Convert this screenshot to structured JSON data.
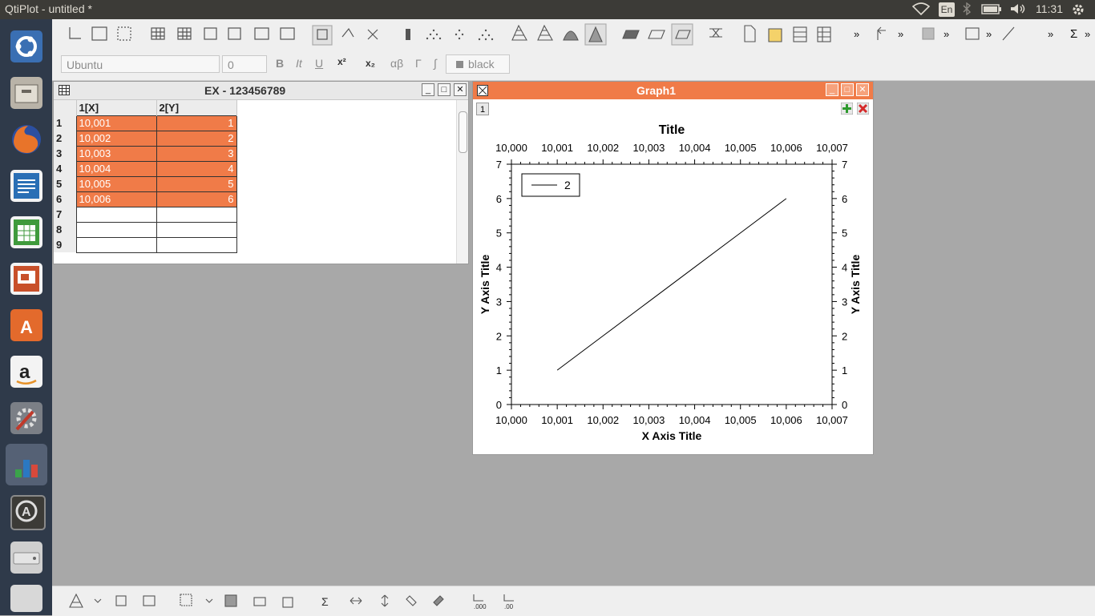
{
  "top_panel": {
    "app_title": "QtiPlot - untitled *",
    "lang": "En",
    "clock": "11:31"
  },
  "launcher": {
    "items": [
      "dash-icon",
      "files-icon",
      "firefox-icon",
      "writer-icon",
      "calc-icon",
      "impress-icon",
      "software-center-icon",
      "amazon-icon",
      "system-settings-icon",
      "qtiplot-icon",
      "software-updater-icon",
      "drive-icon",
      "trash-icon"
    ]
  },
  "format_toolbar": {
    "font": "Ubuntu",
    "size": "0",
    "bold": "B",
    "italic": "It",
    "underline": "U",
    "superscript": "x²",
    "subscript": "x₂",
    "greek_lower": "αβ",
    "greek_upper": "Γ",
    "integral": "∫",
    "color_label": "black"
  },
  "table_window": {
    "title": "EX - 123456789",
    "columns": [
      "1[X]",
      "2[Y]"
    ],
    "rows": [
      {
        "n": "1",
        "x": "10,001",
        "y": "1"
      },
      {
        "n": "2",
        "x": "10,002",
        "y": "2"
      },
      {
        "n": "3",
        "x": "10,003",
        "y": "3"
      },
      {
        "n": "4",
        "x": "10,004",
        "y": "4"
      },
      {
        "n": "5",
        "x": "10,005",
        "y": "5"
      },
      {
        "n": "6",
        "x": "10,006",
        "y": "6"
      },
      {
        "n": "7",
        "x": "",
        "y": ""
      },
      {
        "n": "8",
        "x": "",
        "y": ""
      },
      {
        "n": "9",
        "x": "",
        "y": ""
      }
    ]
  },
  "graph_window": {
    "title": "Graph1",
    "layer_button": "1"
  },
  "chart_data": {
    "type": "line",
    "title": "Title",
    "xlabel": "X Axis Title",
    "ylabel": "Y Axis Title",
    "x_tick_labels": [
      "10,000",
      "10,001",
      "10,002",
      "10,003",
      "10,004",
      "10,005",
      "10,006",
      "10,007"
    ],
    "y_tick_labels": [
      "0",
      "1",
      "2",
      "3",
      "4",
      "5",
      "6",
      "7"
    ],
    "xlim": [
      10.0,
      10.007
    ],
    "ylim": [
      0,
      7
    ],
    "legend_position": "top-left",
    "series": [
      {
        "name": "2",
        "x": [
          10.001,
          10.002,
          10.003,
          10.004,
          10.005,
          10.006
        ],
        "y": [
          1,
          2,
          3,
          4,
          5,
          6
        ]
      }
    ]
  }
}
